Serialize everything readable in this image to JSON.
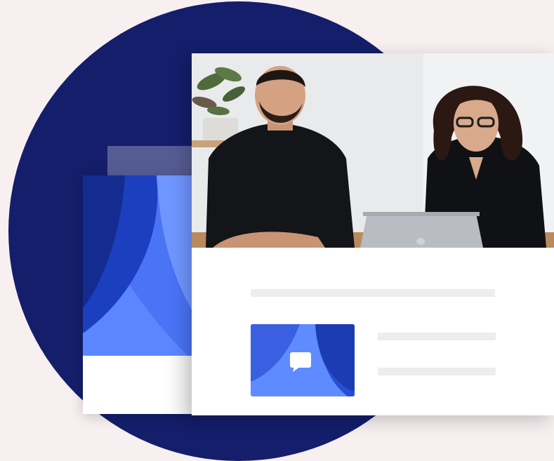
{
  "colors": {
    "background": "#f7eff0",
    "circle": "#141e6b",
    "card": "#ffffff",
    "placeholder_line": "#ededed",
    "accent_blue_dark": "#1a3cb8",
    "accent_blue": "#4a73f5",
    "accent_blue_light": "#6d93ff"
  },
  "front_card": {
    "photo_icon": "photo-of-two-people-at-laptop",
    "media_icon": "chat-bubble-icon",
    "text_placeholders": 3
  },
  "back_card": {
    "art_icon": "abstract-blue-shapes"
  }
}
